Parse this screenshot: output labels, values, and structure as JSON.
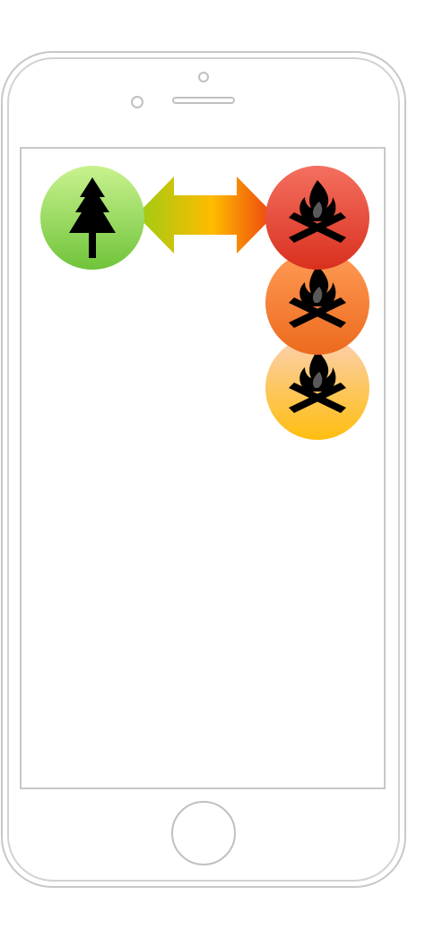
{
  "device": {
    "type": "phone-outline",
    "frame_color": "#c8c8c8"
  },
  "diagram": {
    "nodes": [
      {
        "id": "tree",
        "icon": "pine-tree-icon",
        "gradient": [
          "#c9f28f",
          "#6fc43a"
        ]
      },
      {
        "id": "fire-1",
        "icon": "campfire-icon",
        "gradient": [
          "#f47060",
          "#d9301e"
        ]
      },
      {
        "id": "fire-2",
        "icon": "campfire-icon",
        "gradient": [
          "#ff9b55",
          "#ec6a1e"
        ]
      },
      {
        "id": "fire-3",
        "icon": "campfire-icon",
        "gradient": [
          "#fbd0b4",
          "#ffbe0e"
        ]
      }
    ],
    "connector": {
      "icon": "double-arrow-icon",
      "gradient": [
        "#9ccc14",
        "#ffbb00",
        "#ec4110"
      ]
    }
  }
}
